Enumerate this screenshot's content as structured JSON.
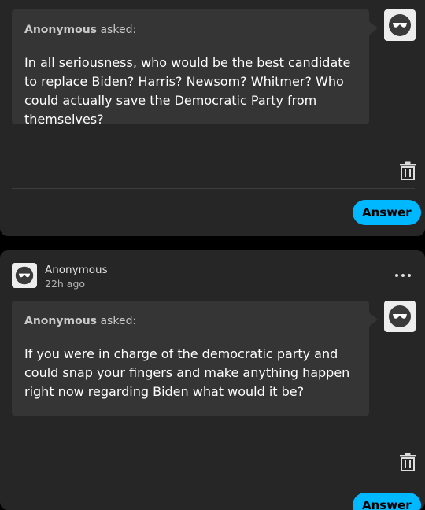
{
  "colors": {
    "accent": "#00b8ff",
    "card_bg": "#262626",
    "bubble_bg": "#353535",
    "page_bg": "#000000"
  },
  "icons": {
    "avatar": "anonymous-sunglasses-avatar-icon",
    "trash": "trash-icon",
    "more": "more-options-icon"
  },
  "posts": [
    {
      "asker": "Anonymous",
      "asked_label": " asked:",
      "question": "In all seriousness, who would be the best candidate to replace Biden? Harris? Newsom? Whitmer? Who could actually save the Democratic Party from themselves?",
      "answer_label": "Answer"
    },
    {
      "poster": "Anonymous",
      "time": "22h ago",
      "asker": "Anonymous",
      "asked_label": " asked:",
      "question": "If you were in charge of the democratic party and could snap your fingers and make anything happen right now regarding Biden what would it be?",
      "answer_label": "Answer"
    }
  ]
}
